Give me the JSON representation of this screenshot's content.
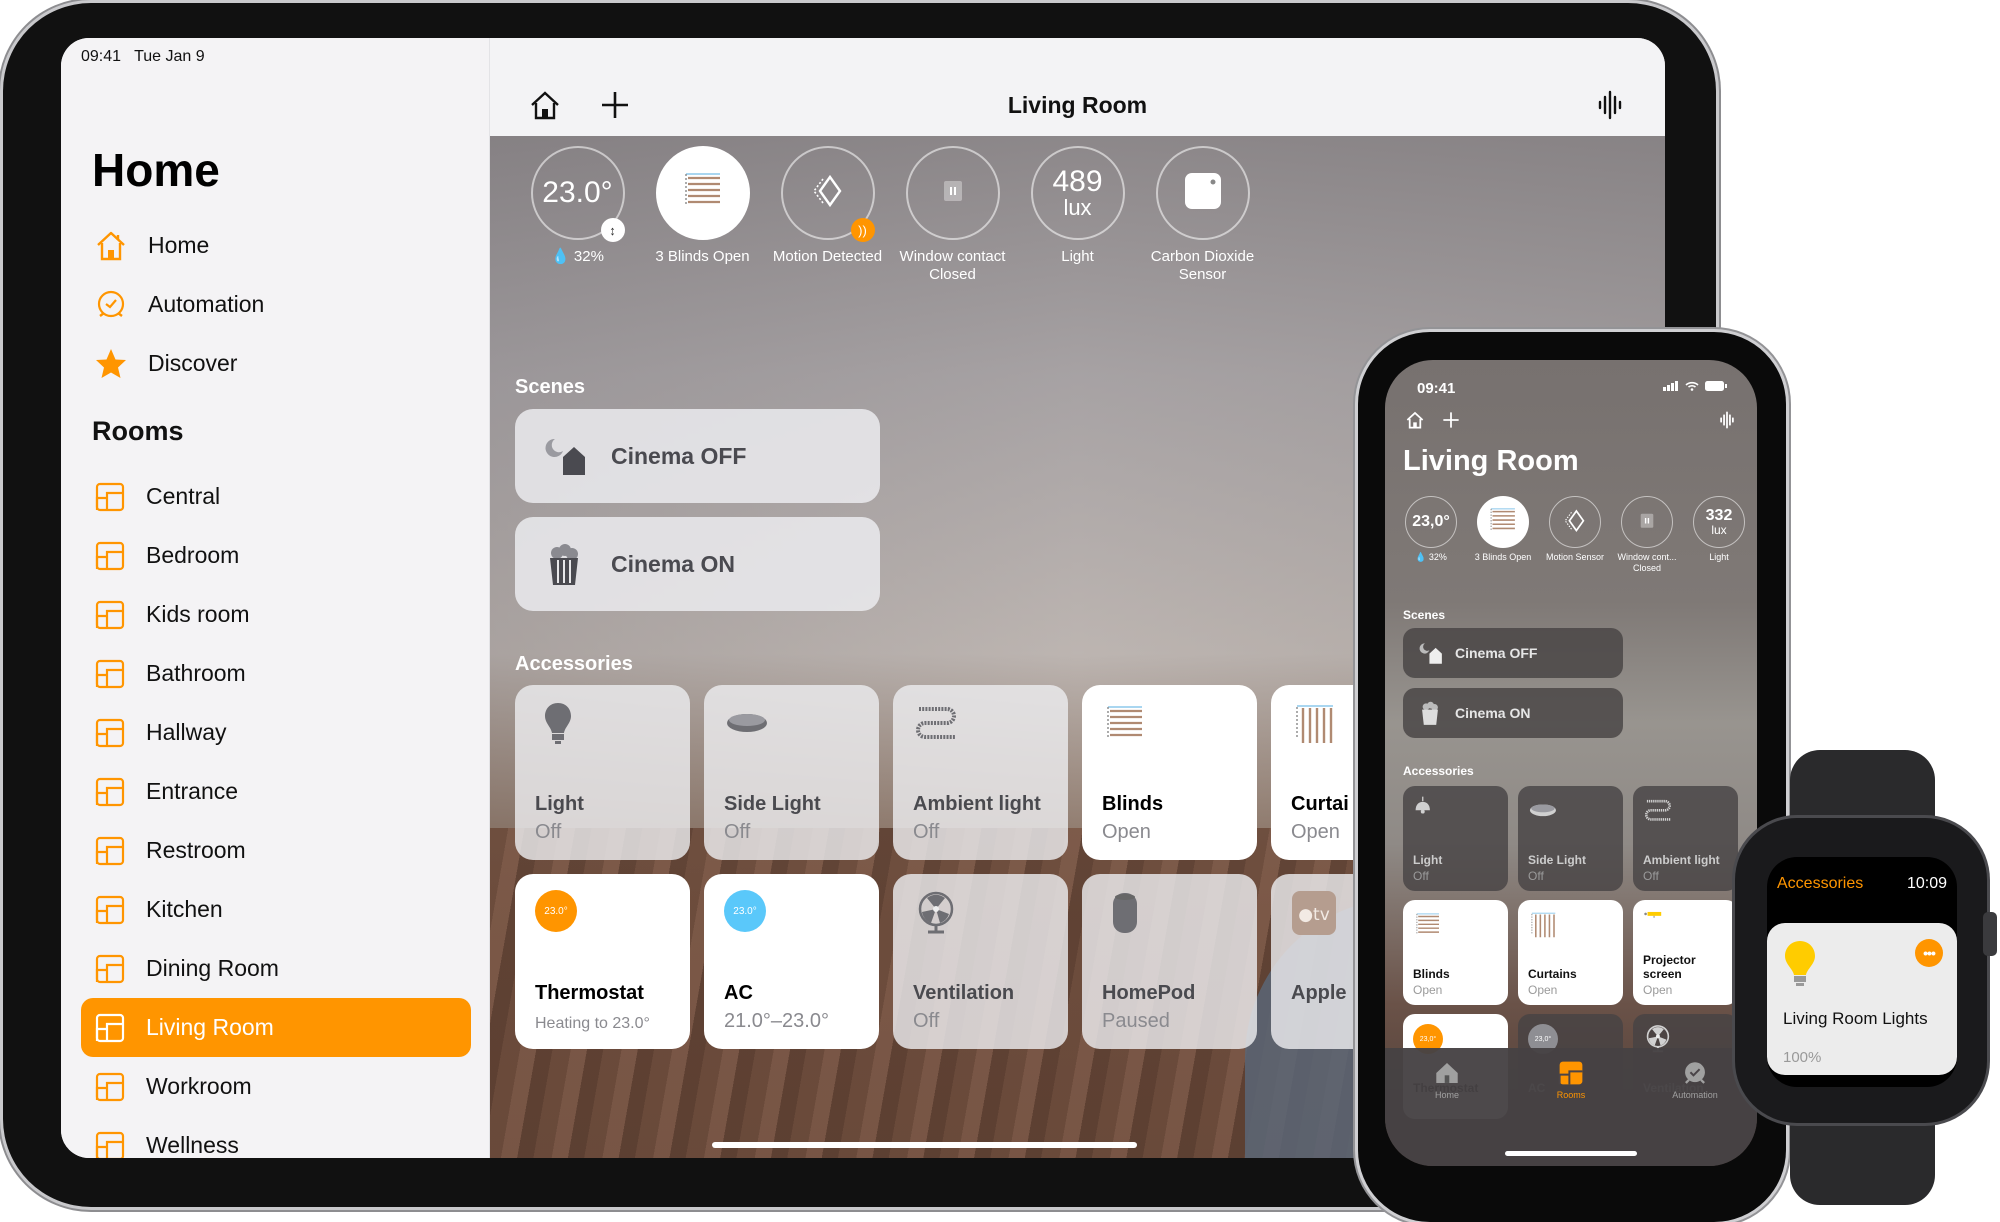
{
  "ipad": {
    "status": {
      "time": "09:41",
      "date": "Tue Jan 9"
    },
    "sidebar": {
      "title": "Home",
      "nav": [
        {
          "label": "Home",
          "icon": "house-icon"
        },
        {
          "label": "Automation",
          "icon": "clock-icon"
        },
        {
          "label": "Discover",
          "icon": "star-icon"
        }
      ],
      "rooms_heading": "Rooms",
      "rooms": [
        {
          "label": "Central",
          "active": false
        },
        {
          "label": "Bedroom",
          "active": false
        },
        {
          "label": "Kids room",
          "active": false
        },
        {
          "label": "Bathroom",
          "active": false
        },
        {
          "label": "Hallway",
          "active": false
        },
        {
          "label": "Entrance",
          "active": false
        },
        {
          "label": "Restroom",
          "active": false
        },
        {
          "label": "Kitchen",
          "active": false
        },
        {
          "label": "Dining Room",
          "active": false
        },
        {
          "label": "Living Room",
          "active": true
        },
        {
          "label": "Workroom",
          "active": false
        },
        {
          "label": "Wellness",
          "active": false
        }
      ]
    },
    "navbar": {
      "title": "Living Room",
      "left_icons": [
        "house-icon",
        "plus-icon"
      ],
      "right_icon": "waveform-icon"
    },
    "status_items": [
      {
        "value": "23.0°",
        "unit": "",
        "label": "💧 32%",
        "badge": "↕",
        "on": false
      },
      {
        "value": "",
        "unit": "",
        "label": "3 Blinds Open",
        "icon": "blinds-icon",
        "on": true
      },
      {
        "value": "",
        "unit": "",
        "label": "Motion Detected",
        "icon": "motion-sensor-icon",
        "badge": "))",
        "on": false
      },
      {
        "value": "",
        "unit": "",
        "label": "Window contact\nClosed",
        "icon": "window-contact-icon",
        "on": false
      },
      {
        "value": "489",
        "unit": "lux",
        "label": "Light",
        "on": false
      },
      {
        "value": "",
        "unit": "",
        "label": "Carbon Dioxide\nSensor",
        "icon": "co2-sensor-icon",
        "on": false
      }
    ],
    "scenes_heading": "Scenes",
    "scenes": [
      {
        "label": "Cinema OFF",
        "icon": "moon-house-icon"
      },
      {
        "label": "Cinema ON",
        "icon": "popcorn-icon"
      }
    ],
    "accessories_heading": "Accessories",
    "accessories": [
      {
        "name": "Light",
        "state": "Off",
        "icon": "bulb-icon",
        "on": false
      },
      {
        "name": "Side Light",
        "state": "Off",
        "icon": "puck-light-icon",
        "on": false
      },
      {
        "name": "Ambient light",
        "state": "Off",
        "icon": "light-strip-icon",
        "on": false
      },
      {
        "name": "Blinds",
        "state": "Open",
        "icon": "blinds-icon",
        "on": true
      },
      {
        "name": "Curtai",
        "state": "Open",
        "icon": "curtains-icon",
        "on": true
      },
      {
        "name": "Thermostat",
        "state": "Heating to 23.0°",
        "icon": "thermostat-icon",
        "temp": "23.0°",
        "temp_color": "#ff9500",
        "on": true
      },
      {
        "name": "AC",
        "state": "21.0°–23.0°",
        "icon": "ac-icon",
        "temp": "23.0°",
        "temp_color": "#5ac8fa",
        "on": true
      },
      {
        "name": "Ventilation",
        "state": "Off",
        "icon": "fan-icon",
        "on": false
      },
      {
        "name": "HomePod",
        "state": "Paused",
        "icon": "homepod-icon",
        "on": false
      },
      {
        "name": "Apple",
        "state": "",
        "icon": "apple-tv-icon",
        "on": false
      }
    ]
  },
  "iphone": {
    "status": {
      "time": "09:41"
    },
    "title": "Living Room",
    "status_items": [
      {
        "value": "23,0°",
        "unit": "",
        "label": "💧 32%",
        "on": false
      },
      {
        "value": "",
        "unit": "",
        "label": "3 Blinds Open",
        "icon": "blinds-icon",
        "on": true
      },
      {
        "value": "",
        "unit": "",
        "label": "Motion Sensor",
        "icon": "motion-sensor-icon",
        "on": false
      },
      {
        "value": "",
        "unit": "",
        "label": "Window cont...\nClosed",
        "icon": "window-contact-icon",
        "on": false
      },
      {
        "value": "332",
        "unit": "lux",
        "label": "Light",
        "on": false
      }
    ],
    "scenes_heading": "Scenes",
    "scenes": [
      {
        "label": "Cinema OFF",
        "icon": "moon-house-icon"
      },
      {
        "label": "Cinema ON",
        "icon": "popcorn-icon"
      }
    ],
    "accessories_heading": "Accessories",
    "accessories": [
      {
        "name": "Light",
        "state": "Off",
        "icon": "pendant-light-icon",
        "on": false
      },
      {
        "name": "Side Light",
        "state": "Off",
        "icon": "puck-light-icon",
        "on": false
      },
      {
        "name": "Ambient light",
        "state": "Off",
        "icon": "light-strip-icon",
        "on": false
      },
      {
        "name": "Blinds",
        "state": "Open",
        "icon": "blinds-icon",
        "on": true
      },
      {
        "name": "Curtains",
        "state": "Open",
        "icon": "curtains-icon",
        "on": true
      },
      {
        "name": "Projector screen",
        "state": "Open",
        "icon": "projector-screen-icon",
        "on": true
      },
      {
        "name": "Thermostat",
        "state": "",
        "icon": "thermostat-icon",
        "temp": "23,0°",
        "temp_color": "#ff9500",
        "on": true
      },
      {
        "name": "AC",
        "state": "",
        "icon": "ac-icon",
        "temp": "23,0°",
        "temp_color": "#8e8e93",
        "on": false
      },
      {
        "name": "Ventilation",
        "state": "",
        "icon": "fan-icon",
        "on": false
      }
    ],
    "tabs": [
      {
        "label": "Home",
        "icon": "house-icon",
        "active": false
      },
      {
        "label": "Rooms",
        "icon": "rooms-icon",
        "active": true
      },
      {
        "label": "Automation",
        "icon": "clock-icon",
        "active": false
      }
    ]
  },
  "watch": {
    "title": "Accessories",
    "time": "10:09",
    "card": {
      "name": "Living Room Lights",
      "state": "100%",
      "icon": "bulb-icon",
      "more": "•••"
    }
  },
  "colors": {
    "accent": "#ff9500",
    "ac_blue": "#5ac8fa"
  }
}
